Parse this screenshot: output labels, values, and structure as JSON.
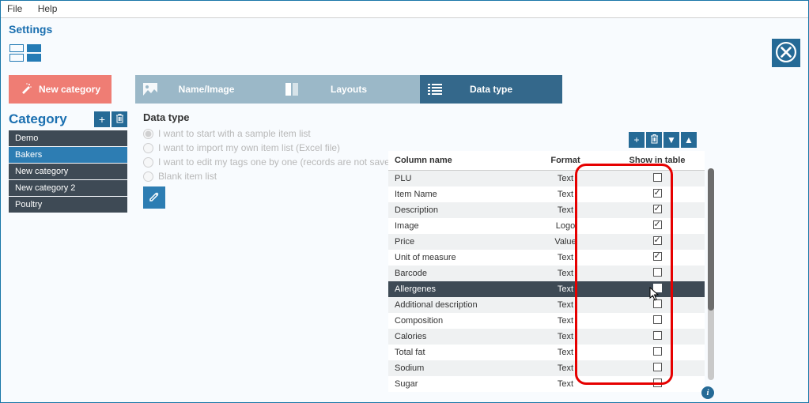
{
  "menu": {
    "file": "File",
    "help": "Help"
  },
  "title": "Settings",
  "newCategoryButton": "New category",
  "tabs": {
    "nameImage": "Name/Image",
    "layouts": "Layouts",
    "dataType": "Data type"
  },
  "sidebar": {
    "heading": "Category",
    "items": [
      "Demo",
      "Bakers",
      "New category",
      "New category 2",
      "Poultry"
    ],
    "selectedIndex": 1
  },
  "dataTypeSection": {
    "title": "Data type",
    "options": [
      "I want to start with a sample item list",
      "I want to import my own item list (Excel file)",
      "I want to edit my tags one by one (records are not saved)",
      "Blank item list"
    ],
    "selectedOption": 0
  },
  "table": {
    "headers": {
      "name": "Column name",
      "format": "Format",
      "show": "Show in table"
    },
    "selectedIndex": 7,
    "rows": [
      {
        "name": "PLU",
        "format": "Text",
        "show": false
      },
      {
        "name": "Item Name",
        "format": "Text",
        "show": true
      },
      {
        "name": "Description",
        "format": "Text",
        "show": true
      },
      {
        "name": "Image",
        "format": "Logo",
        "show": true
      },
      {
        "name": "Price",
        "format": "Value",
        "show": true
      },
      {
        "name": "Unit of measure",
        "format": "Text",
        "show": true
      },
      {
        "name": "Barcode",
        "format": "Text",
        "show": false
      },
      {
        "name": "Allergenes",
        "format": "Text",
        "show": true
      },
      {
        "name": "Additional description",
        "format": "Text",
        "show": false
      },
      {
        "name": "Composition",
        "format": "Text",
        "show": false
      },
      {
        "name": "Calories",
        "format": "Text",
        "show": false
      },
      {
        "name": "Total fat",
        "format": "Text",
        "show": false
      },
      {
        "name": "Sodium",
        "format": "Text",
        "show": false
      },
      {
        "name": "Sugar",
        "format": "Text",
        "show": false
      }
    ]
  }
}
